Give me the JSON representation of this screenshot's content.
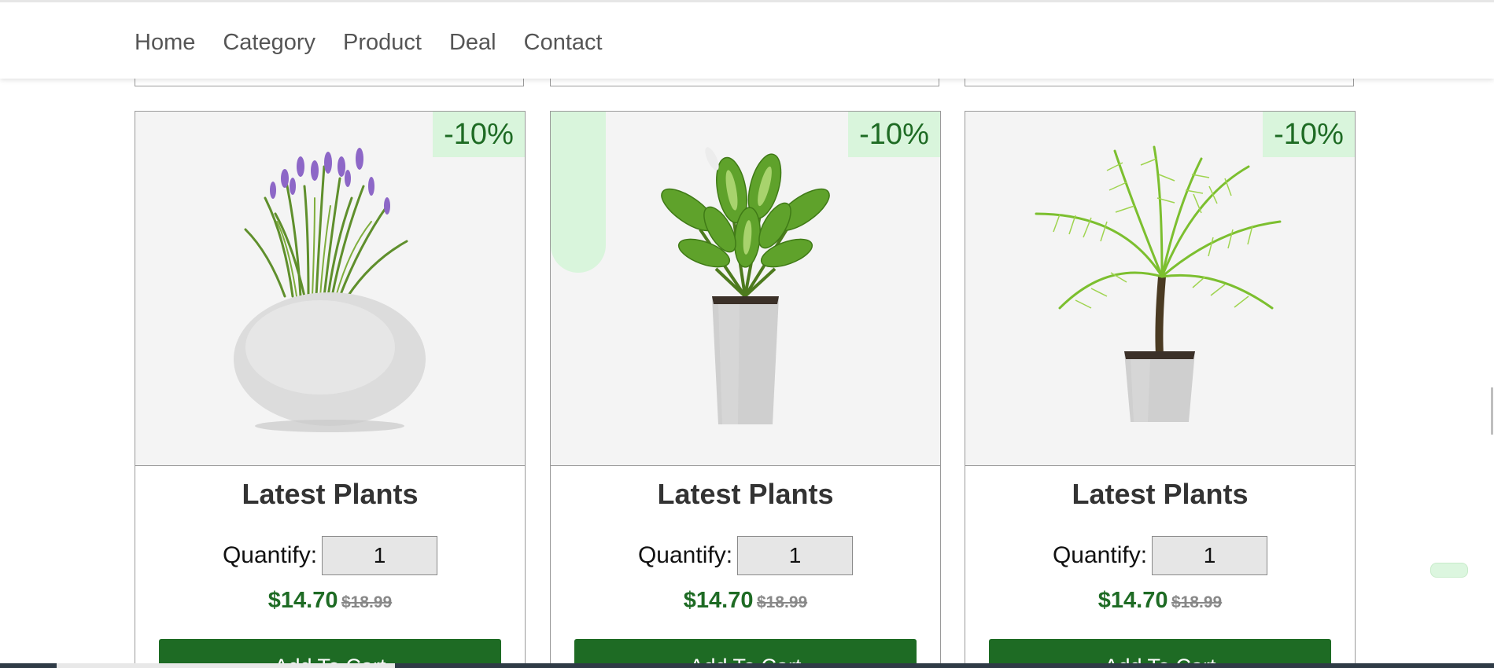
{
  "nav": {
    "items": [
      {
        "label": "Home"
      },
      {
        "label": "Category"
      },
      {
        "label": "Product"
      },
      {
        "label": "Deal"
      },
      {
        "label": "Contact"
      }
    ]
  },
  "products": [
    {
      "image_icon": "lavender-in-stone-pot-icon",
      "discount": "-10%",
      "title": "Latest Plants",
      "quantity_label": "Quantify:",
      "quantity_value": "1",
      "price": "$14.70",
      "old_price": "$18.99",
      "button_label": "Add To Cart"
    },
    {
      "image_icon": "dieffenbachia-in-tall-pot-icon",
      "discount": "-10%",
      "title": "Latest Plants",
      "quantity_label": "Quantify:",
      "quantity_value": "1",
      "price": "$14.70",
      "old_price": "$18.99",
      "button_label": "Add To Cart"
    },
    {
      "image_icon": "palm-in-square-pot-icon",
      "discount": "-10%",
      "title": "Latest Plants",
      "quantity_label": "Quantify:",
      "quantity_value": "1",
      "price": "$14.70",
      "old_price": "$18.99",
      "button_label": "Add To Cart"
    }
  ],
  "colors": {
    "accent_green": "#1e6b24",
    "badge_bg": "#d9f5dc",
    "image_bg": "#f4f4f4"
  }
}
